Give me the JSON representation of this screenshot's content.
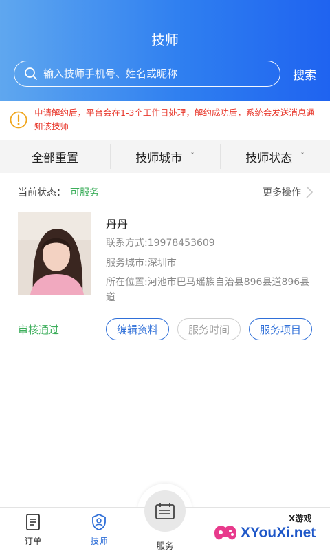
{
  "header": {
    "title": "技师",
    "search_placeholder": "输入技师手机号、姓名或昵称",
    "search_button": "搜索"
  },
  "notice": {
    "text": "申请解约后，平台会在1-3个工作日处理，解约成功后，系统会发送消息通知该技师"
  },
  "filters": {
    "reset": "全部重置",
    "city": "技师城市",
    "status": "技师状态",
    "chevron": "ˇ"
  },
  "status_row": {
    "label": "当前状态：",
    "value": "可服务",
    "more": "更多操作"
  },
  "technician": {
    "name": "丹丹",
    "phone": "联系方式:19978453609",
    "city": "服务城市:深圳市",
    "address": "所在位置:河池市巴马瑶族自治县896县道896县道",
    "approval": "审核通过"
  },
  "actions": {
    "edit": "编辑资料",
    "time": "服务时间",
    "items": "服务项目"
  },
  "tabbar": {
    "orders": "订单",
    "tech": "技师",
    "service": "服务"
  },
  "watermark": {
    "sub": "X游戏",
    "main": "XYouXi.net"
  },
  "colors": {
    "accent": "#2f6fd8",
    "header_start": "#5fa7ef",
    "header_end": "#1f63f0",
    "warning": "#e8382c",
    "success": "#3cae5b"
  }
}
